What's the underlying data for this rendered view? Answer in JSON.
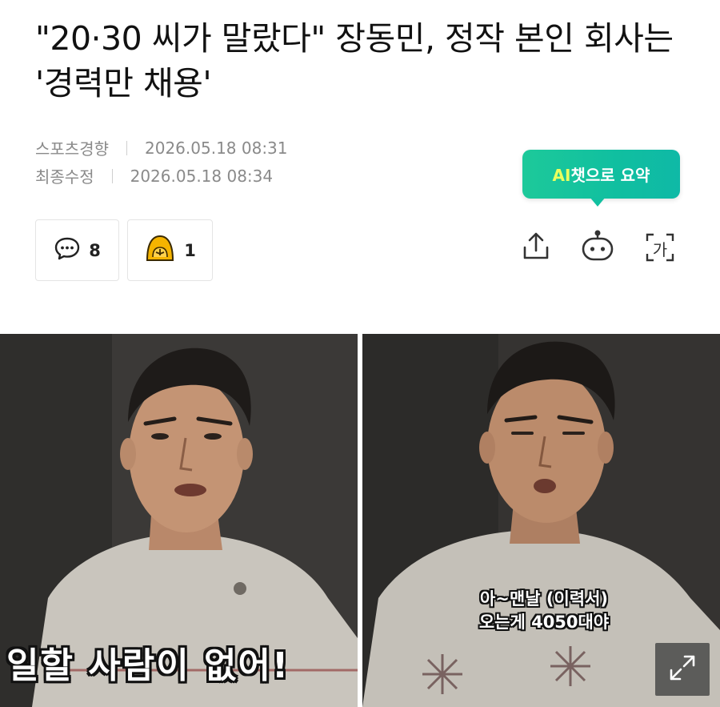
{
  "article": {
    "title": "\"20·30 씨가 말랐다\" 장동민, 정작 본인 회사는 '경력만 채용'",
    "source": "스포츠경향",
    "published": "2026.05.18 08:31",
    "modified_label": "최종수정",
    "modified": "2026.05.18 08:34"
  },
  "ai_summary": {
    "label_ai": "AI",
    "label_chat": "챗으로 요약"
  },
  "reactions": {
    "comment_count": "8",
    "reaction_count": "1"
  },
  "toolbar": {
    "font_label": "가"
  },
  "images": {
    "left_caption": "일할 사람이 없어!",
    "right_caption_line1": "아~맨날 (이력서)",
    "right_caption_line2": "오는게 4050대야"
  },
  "colors": {
    "accent_green": "#1dc99a",
    "meta_gray": "#8a8a8a",
    "reaction_yellow": "#f5b400"
  },
  "icons": [
    "comment-icon",
    "reaction-emoji-icon",
    "share-icon",
    "chatbot-icon",
    "font-size-icon",
    "expand-icon"
  ]
}
